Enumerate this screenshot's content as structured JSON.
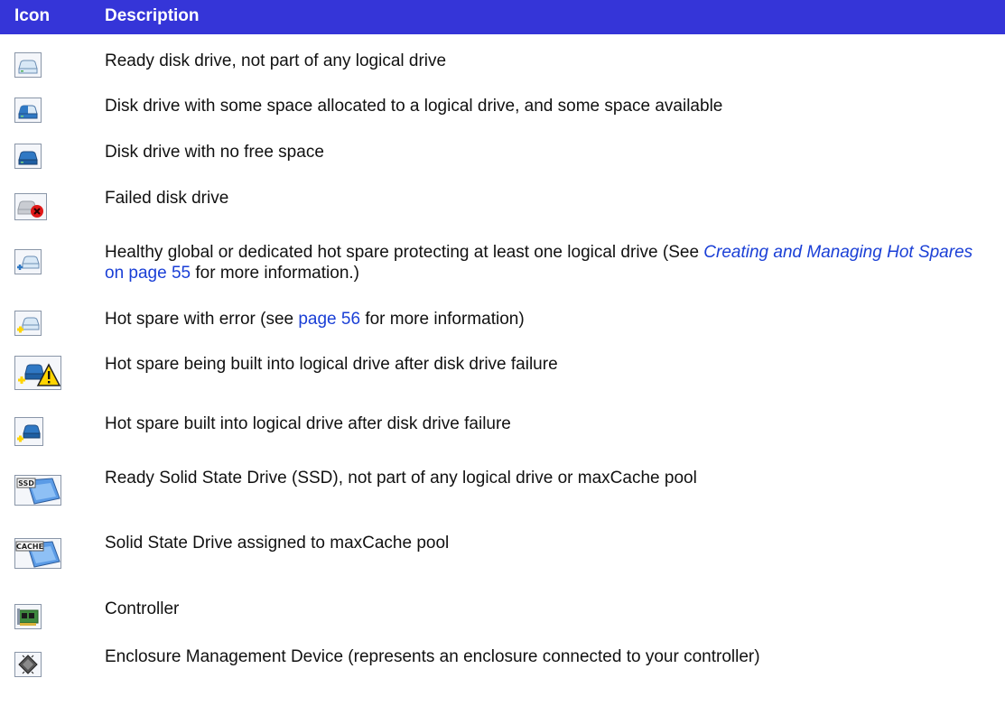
{
  "header": {
    "col_icon": "Icon",
    "col_description": "Description"
  },
  "colors": {
    "header_bg": "#3535d8",
    "link": "#1a3fd6",
    "drive_blue": "#2f78c4",
    "warning": "#ffd400",
    "error": "#e01818"
  },
  "rows": [
    {
      "icon": "ready-disk-drive-icon",
      "text": "Ready disk drive, not part of any logical drive"
    },
    {
      "icon": "partial-disk-drive-icon",
      "text": "Disk drive with some space allocated to a logical drive, and some space available"
    },
    {
      "icon": "full-disk-drive-icon",
      "text": "Disk drive with no free space"
    },
    {
      "icon": "failed-disk-drive-icon",
      "text": "Failed disk drive"
    },
    {
      "icon": "healthy-hot-spare-icon",
      "text_before": "Healthy global or dedicated hot spare protecting at least one logical drive (See ",
      "link_italic": "Creating and Managing Hot Spares",
      "link_plain": " on page 55",
      "text_after": " for more information.)"
    },
    {
      "icon": "hot-spare-error-icon",
      "text_before": "Hot spare with error (see ",
      "link": "page 56",
      "text_after": " for more information)"
    },
    {
      "icon": "hot-spare-building-icon",
      "text": "Hot spare being built into logical drive after disk drive failure"
    },
    {
      "icon": "hot-spare-built-icon",
      "text": "Hot spare built into logical drive after disk drive failure"
    },
    {
      "icon": "ssd-ready-icon",
      "icon_label": "SSD",
      "text": "Ready Solid State Drive (SSD), not part of any logical drive or maxCache pool"
    },
    {
      "icon": "ssd-cache-icon",
      "icon_label": "CACHE",
      "text": "Solid State Drive assigned to maxCache pool"
    },
    {
      "icon": "controller-icon",
      "text": "Controller"
    },
    {
      "icon": "enclosure-management-device-icon",
      "text": "Enclosure Management Device (represents an enclosure connected to your controller)"
    }
  ]
}
